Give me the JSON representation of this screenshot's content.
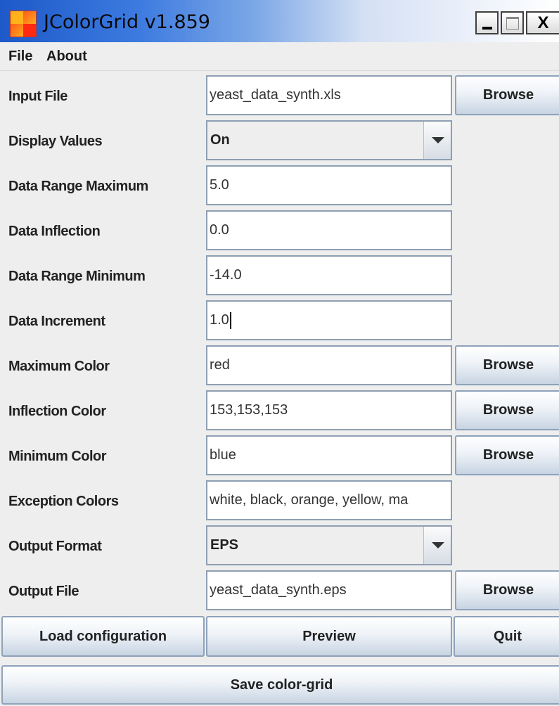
{
  "window": {
    "title": "JColorGrid v1.859",
    "controls": {
      "minimize": "_",
      "maximize": "□",
      "close": "X"
    }
  },
  "menu": {
    "file": "File",
    "about": "About"
  },
  "form": {
    "input_file": {
      "label": "Input File",
      "value": "yeast_data_synth.xls",
      "browse": "Browse"
    },
    "display_values": {
      "label": "Display Values",
      "selected": "On"
    },
    "data_range_maximum": {
      "label": "Data Range Maximum",
      "value": "5.0"
    },
    "data_inflection": {
      "label": "Data Inflection",
      "value": "0.0"
    },
    "data_range_minimum": {
      "label": "Data Range Minimum",
      "value": "-14.0"
    },
    "data_increment": {
      "label": "Data Increment",
      "value": "1.0"
    },
    "maximum_color": {
      "label": "Maximum Color",
      "value": "red",
      "browse": "Browse"
    },
    "inflection_color": {
      "label": "Inflection Color",
      "value": "153,153,153",
      "browse": "Browse"
    },
    "minimum_color": {
      "label": "Minimum Color",
      "value": "blue",
      "browse": "Browse"
    },
    "exception_colors": {
      "label": "Exception Colors",
      "value": "white, black, orange, yellow, ma"
    },
    "output_format": {
      "label": "Output Format",
      "selected": "EPS"
    },
    "output_file": {
      "label": "Output File",
      "value": "yeast_data_synth.eps",
      "browse": "Browse"
    }
  },
  "actions": {
    "load_configuration": "Load configuration",
    "preview": "Preview",
    "quit": "Quit",
    "save_color_grid": "Save color-grid"
  },
  "icons": {
    "app": "jcolorgrid-app-icon",
    "dropdown": "chevron-down-icon"
  }
}
